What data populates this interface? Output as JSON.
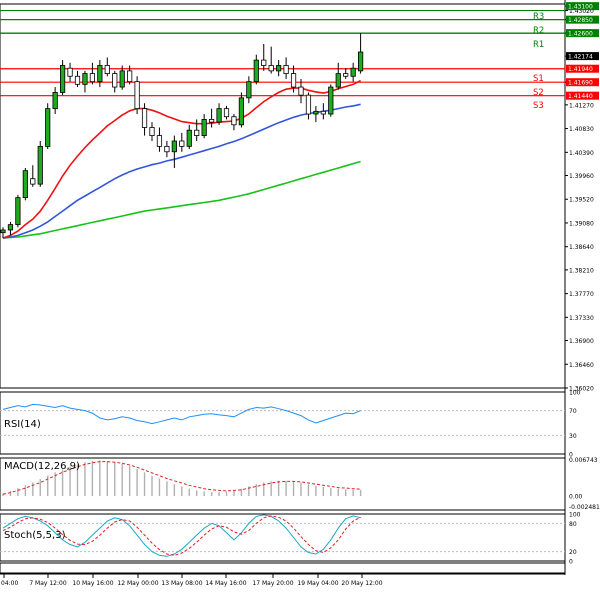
{
  "chart_data": [
    {
      "type": "candlestick",
      "x_ticks": [
        "04:00",
        "7 May 12:00",
        "10 May 16:00",
        "12 May 00:00",
        "13 May 08:00",
        "14 May 16:00",
        "17 May 20:00",
        "19 May 04:00",
        "20 May 12:00"
      ],
      "y_ticks": [
        1.3602,
        1.3646,
        1.369,
        1.3733,
        1.3777,
        1.3821,
        1.3864,
        1.3908,
        1.3952,
        1.3996,
        1.4039,
        1.4083,
        1.4127,
        1.4169,
        1.42174,
        1.426,
        1.4285,
        1.4302,
        1.431
      ],
      "ylim": [
        1.3602,
        1.4314
      ],
      "current_price": 1.42174,
      "levels": [
        {
          "name": "R3",
          "value": 1.4285,
          "color": "#008000"
        },
        {
          "name": "R2",
          "value": 1.426,
          "color": "#008000"
        },
        {
          "name": "R1",
          "value": 1.426,
          "color": "#008000"
        },
        {
          "name": "S1",
          "value": 1.4194,
          "color": "#ff0000"
        },
        {
          "name": "S2",
          "value": 1.4169,
          "color": "#ff0000"
        },
        {
          "name": "S3",
          "value": 1.4144,
          "color": "#ff0000"
        }
      ],
      "level_price_labels": [
        "1.43100",
        "1.42850",
        "1.42600",
        "1.41940",
        "1.41690",
        "1.41440"
      ],
      "candles": [
        [
          1.389,
          1.39,
          1.388,
          1.3895
        ],
        [
          1.3895,
          1.391,
          1.3885,
          1.3905
        ],
        [
          1.3905,
          1.396,
          1.39,
          1.3955
        ],
        [
          1.3955,
          1.401,
          1.395,
          1.4005
        ],
        [
          1.399,
          1.4015,
          1.3975,
          1.398
        ],
        [
          1.398,
          1.406,
          1.3975,
          1.405
        ],
        [
          1.405,
          1.413,
          1.4045,
          1.412
        ],
        [
          1.412,
          1.416,
          1.411,
          1.415
        ],
        [
          1.415,
          1.421,
          1.4145,
          1.42
        ],
        [
          1.4195,
          1.4205,
          1.417,
          1.418
        ],
        [
          1.418,
          1.419,
          1.416,
          1.4165
        ],
        [
          1.4165,
          1.419,
          1.415,
          1.4185
        ],
        [
          1.4185,
          1.4205,
          1.4165,
          1.417
        ],
        [
          1.417,
          1.421,
          1.416,
          1.42
        ],
        [
          1.42,
          1.4215,
          1.418,
          1.4185
        ],
        [
          1.4185,
          1.419,
          1.415,
          1.416
        ],
        [
          1.416,
          1.42,
          1.4155,
          1.419
        ],
        [
          1.419,
          1.42,
          1.4165,
          1.417
        ],
        [
          1.417,
          1.418,
          1.411,
          1.412
        ],
        [
          1.412,
          1.413,
          1.407,
          1.4085
        ],
        [
          1.4085,
          1.4095,
          1.406,
          1.407
        ],
        [
          1.407,
          1.4085,
          1.404,
          1.405
        ],
        [
          1.405,
          1.406,
          1.403,
          1.404
        ],
        [
          1.404,
          1.407,
          1.401,
          1.406
        ],
        [
          1.406,
          1.4075,
          1.404,
          1.405
        ],
        [
          1.405,
          1.409,
          1.4045,
          1.408
        ],
        [
          1.408,
          1.41,
          1.406,
          1.407
        ],
        [
          1.407,
          1.411,
          1.4065,
          1.41
        ],
        [
          1.41,
          1.412,
          1.4085,
          1.4095
        ],
        [
          1.4095,
          1.413,
          1.409,
          1.412
        ],
        [
          1.412,
          1.4125,
          1.41,
          1.4105
        ],
        [
          1.4105,
          1.411,
          1.408,
          1.409
        ],
        [
          1.409,
          1.415,
          1.4085,
          1.414
        ],
        [
          1.414,
          1.418,
          1.413,
          1.417
        ],
        [
          1.417,
          1.422,
          1.4165,
          1.421
        ],
        [
          1.421,
          1.424,
          1.419,
          1.42
        ],
        [
          1.42,
          1.4235,
          1.4185,
          1.419
        ],
        [
          1.419,
          1.421,
          1.418,
          1.42
        ],
        [
          1.42,
          1.4215,
          1.4175,
          1.4185
        ],
        [
          1.4185,
          1.42,
          1.415,
          1.416
        ],
        [
          1.416,
          1.4175,
          1.413,
          1.4145
        ],
        [
          1.4145,
          1.415,
          1.41,
          1.411
        ],
        [
          1.411,
          1.4125,
          1.4095,
          1.4115
        ],
        [
          1.4115,
          1.413,
          1.41,
          1.411
        ],
        [
          1.411,
          1.4165,
          1.4105,
          1.416
        ],
        [
          1.416,
          1.4205,
          1.4155,
          1.4185
        ],
        [
          1.4185,
          1.4195,
          1.4175,
          1.418
        ],
        [
          1.418,
          1.4205,
          1.417,
          1.4195
        ],
        [
          1.419,
          1.426,
          1.4185,
          1.4225
        ]
      ],
      "ma_fast": [
        1.388,
        1.3885,
        1.3893,
        1.3905,
        1.3915,
        1.393,
        1.395,
        1.3972,
        1.3995,
        1.4015,
        1.4032,
        1.4048,
        1.4062,
        1.4075,
        1.4088,
        1.4098,
        1.4108,
        1.4116,
        1.412,
        1.412,
        1.4117,
        1.4112,
        1.4106,
        1.4101,
        1.4096,
        1.4094,
        1.4092,
        1.4092,
        1.4093,
        1.4095,
        1.4096,
        1.4097,
        1.4102,
        1.411,
        1.4122,
        1.4133,
        1.4142,
        1.415,
        1.4156,
        1.4158,
        1.4158,
        1.4154,
        1.4151,
        1.4149,
        1.4152,
        1.4157,
        1.4161,
        1.4165,
        1.4172
      ],
      "ma_mid": [
        1.388,
        1.3882,
        1.3885,
        1.389,
        1.3895,
        1.3902,
        1.391,
        1.392,
        1.393,
        1.394,
        1.395,
        1.3958,
        1.3966,
        1.3974,
        1.3982,
        1.399,
        1.3997,
        1.4003,
        1.4008,
        1.4012,
        1.4016,
        1.4019,
        1.4023,
        1.4026,
        1.403,
        1.4034,
        1.4038,
        1.4042,
        1.4046,
        1.405,
        1.4055,
        1.4059,
        1.4064,
        1.407,
        1.4076,
        1.4082,
        1.4088,
        1.4094,
        1.4099,
        1.4104,
        1.4108,
        1.4111,
        1.4113,
        1.4115,
        1.4117,
        1.412,
        1.4123,
        1.4125,
        1.4128
      ],
      "ma_slow": [
        1.388,
        1.3881,
        1.3882,
        1.3884,
        1.3886,
        1.3888,
        1.3891,
        1.3894,
        1.3897,
        1.39,
        1.3903,
        1.3906,
        1.3909,
        1.3912,
        1.3915,
        1.3918,
        1.3921,
        1.3924,
        1.3927,
        1.393,
        1.3932,
        1.3934,
        1.3936,
        1.3938,
        1.394,
        1.3942,
        1.3944,
        1.3946,
        1.3948,
        1.395,
        1.3953,
        1.3956,
        1.3959,
        1.3962,
        1.3966,
        1.397,
        1.3974,
        1.3978,
        1.3982,
        1.3986,
        1.399,
        1.3994,
        1.3998,
        1.4002,
        1.4006,
        1.401,
        1.4014,
        1.4018,
        1.4022
      ]
    },
    {
      "type": "line",
      "label": "RSI(14)",
      "y_ticks": [
        100,
        70,
        30,
        0
      ],
      "ylim": [
        0,
        100
      ],
      "values": [
        72,
        75,
        78,
        76,
        80,
        79,
        77,
        75,
        78,
        74,
        72,
        70,
        66,
        58,
        55,
        57,
        60,
        58,
        54,
        52,
        49,
        52,
        55,
        58,
        55,
        60,
        62,
        64,
        65,
        63,
        62,
        60,
        66,
        72,
        75,
        74,
        76,
        73,
        70,
        66,
        62,
        55,
        50,
        54,
        58,
        62,
        66,
        65,
        70
      ]
    },
    {
      "type": "bar",
      "label": "MACD(12,26,9)",
      "y_ticks": [
        0.006743,
        0.0,
        -0.002481
      ],
      "ylim": [
        -0.002481,
        0.006743
      ],
      "values": [
        0.0005,
        0.0009,
        0.0014,
        0.0019,
        0.0024,
        0.003,
        0.0036,
        0.0042,
        0.0047,
        0.0052,
        0.0056,
        0.006,
        0.0062,
        0.0063,
        0.0062,
        0.006,
        0.0057,
        0.0053,
        0.0048,
        0.0042,
        0.0036,
        0.0031,
        0.0026,
        0.0021,
        0.0017,
        0.0013,
        0.001,
        0.0008,
        0.0007,
        0.0007,
        0.0008,
        0.001,
        0.0013,
        0.0017,
        0.0021,
        0.0024,
        0.0026,
        0.0027,
        0.0027,
        0.0026,
        0.0024,
        0.0021,
        0.0018,
        0.0016,
        0.0014,
        0.0013,
        0.0012,
        0.0011,
        0.0011
      ],
      "signal": [
        0.0003,
        0.0006,
        0.001,
        0.0014,
        0.0019,
        0.0024,
        0.003,
        0.0036,
        0.0042,
        0.0047,
        0.0052,
        0.0056,
        0.0059,
        0.0061,
        0.0061,
        0.006,
        0.0058,
        0.0055,
        0.0051,
        0.0046,
        0.0041,
        0.0036,
        0.0031,
        0.0027,
        0.0023,
        0.0019,
        0.0016,
        0.0013,
        0.0011,
        0.001,
        0.0009,
        0.001,
        0.0011,
        0.0014,
        0.0017,
        0.002,
        0.0023,
        0.0025,
        0.0026,
        0.0026,
        0.0025,
        0.0023,
        0.0021,
        0.0019,
        0.0017,
        0.0015,
        0.0014,
        0.0013,
        0.0012
      ]
    },
    {
      "type": "line",
      "label": "Stoch(5,5,3)",
      "y_ticks": [
        100,
        80,
        20,
        0
      ],
      "ylim": [
        0,
        100
      ],
      "values": [
        70,
        80,
        90,
        95,
        92,
        85,
        75,
        60,
        45,
        35,
        30,
        40,
        55,
        70,
        85,
        92,
        88,
        75,
        55,
        35,
        20,
        12,
        10,
        15,
        25,
        40,
        55,
        70,
        80,
        75,
        60,
        45,
        60,
        80,
        95,
        98,
        95,
        85,
        70,
        50,
        30,
        18,
        15,
        25,
        45,
        70,
        90,
        96,
        92
      ],
      "signal": [
        65,
        72,
        82,
        90,
        92,
        89,
        82,
        70,
        56,
        44,
        36,
        35,
        42,
        55,
        70,
        83,
        88,
        85,
        72,
        55,
        38,
        24,
        15,
        12,
        17,
        27,
        40,
        55,
        68,
        75,
        72,
        62,
        57,
        65,
        80,
        92,
        96,
        93,
        85,
        70,
        52,
        35,
        22,
        18,
        28,
        45,
        68,
        85,
        93
      ]
    }
  ]
}
